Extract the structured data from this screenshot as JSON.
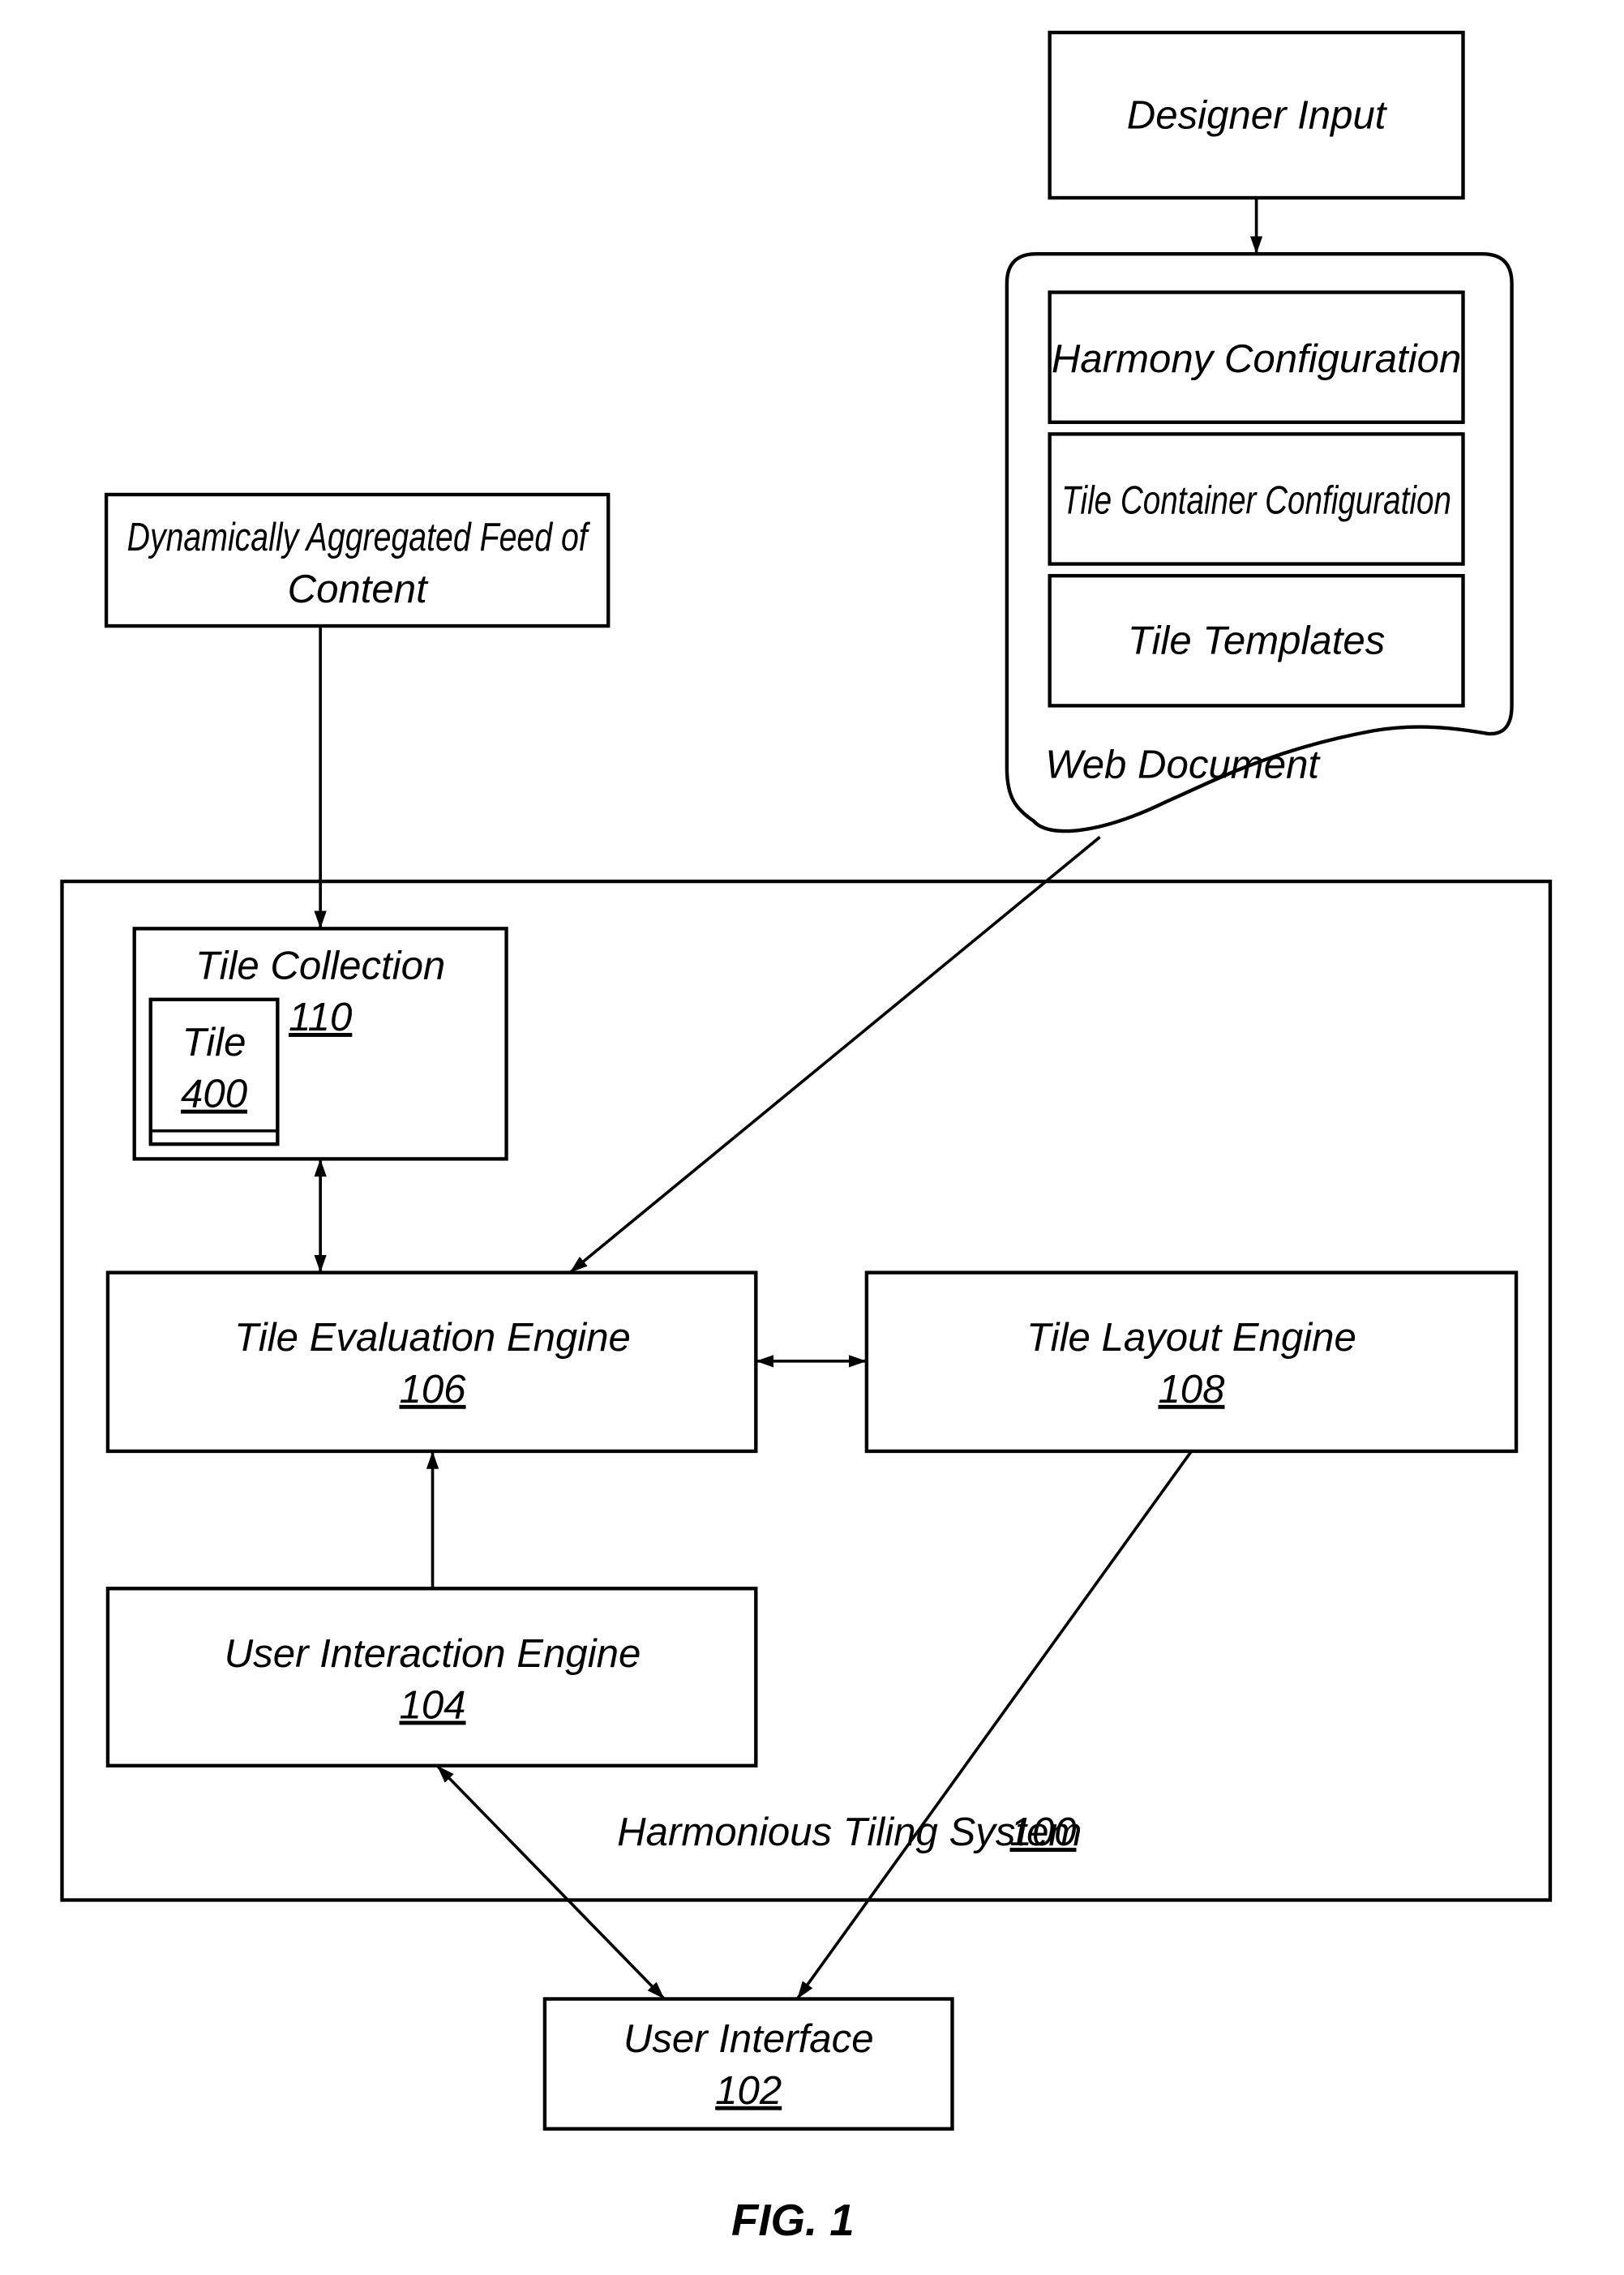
{
  "figure": {
    "caption": "FIG. 1",
    "designer_input": {
      "label": "Designer Input"
    },
    "web_document": {
      "label": "Web Document",
      "items": [
        {
          "label": "Harmony Configuration"
        },
        {
          "label": "Tile Container Configuration"
        },
        {
          "label": "Tile Templates"
        }
      ]
    },
    "feed": {
      "line1": "Dynamically Aggregated Feed of",
      "line2": "Content"
    },
    "system": {
      "label": "Harmonious Tiling System",
      "ref": "100"
    },
    "tile_collection": {
      "label": "Tile Collection",
      "ref": "110"
    },
    "tile": {
      "label": "Tile",
      "ref": "400"
    },
    "tile_evaluation_engine": {
      "label": "Tile Evaluation Engine",
      "ref": "106"
    },
    "tile_layout_engine": {
      "label": "Tile Layout Engine",
      "ref": "108"
    },
    "user_interaction_engine": {
      "label": "User Interaction Engine",
      "ref": "104"
    },
    "user_interface": {
      "label": "User Interface",
      "ref": "102"
    },
    "connections": [
      {
        "from": "Designer Input",
        "to": "Web Document",
        "type": "one-way"
      },
      {
        "from": "Dynamically Aggregated Feed of Content",
        "to": "Tile Collection",
        "type": "one-way"
      },
      {
        "from": "Web Document",
        "to": "Tile Evaluation Engine",
        "type": "one-way"
      },
      {
        "from": "Tile Collection",
        "to": "Tile Evaluation Engine",
        "type": "two-way"
      },
      {
        "from": "Tile Evaluation Engine",
        "to": "Tile Layout Engine",
        "type": "two-way"
      },
      {
        "from": "User Interaction Engine",
        "to": "Tile Evaluation Engine",
        "type": "one-way"
      },
      {
        "from": "User Interaction Engine",
        "to": "User Interface",
        "type": "two-way"
      },
      {
        "from": "Tile Layout Engine",
        "to": "User Interface",
        "type": "one-way"
      }
    ]
  }
}
